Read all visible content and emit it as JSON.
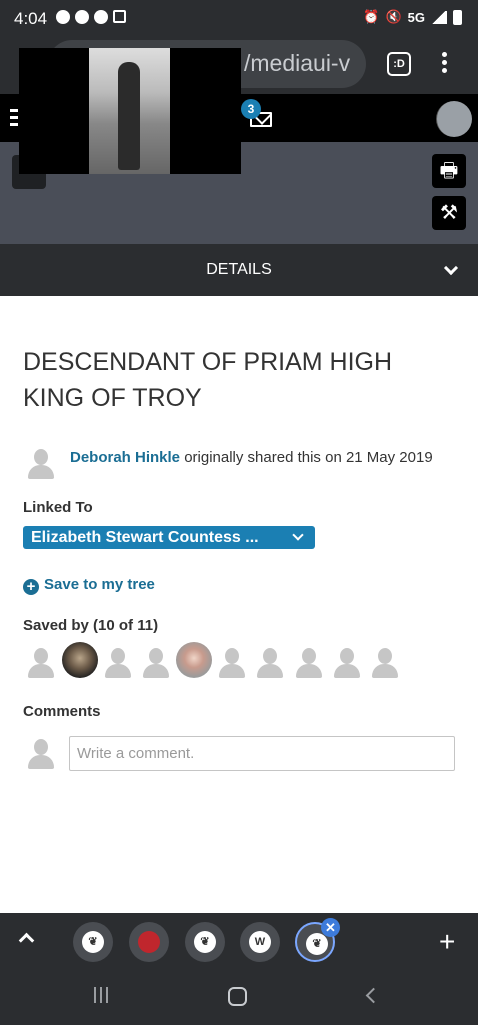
{
  "status_bar": {
    "time": "4:04",
    "network": "5G"
  },
  "browser": {
    "url_fragment": "/mediaui-v",
    "tab_label": ":D"
  },
  "header": {
    "message_count": "3"
  },
  "details_bar": {
    "label": "DETAILS"
  },
  "media": {
    "title": "DESCENDANT OF PRIAM HIGH KING OF TROY",
    "shared_by": "Deborah Hinkle",
    "shared_text": " originally shared this on 21 May 2019"
  },
  "linked_to": {
    "label": "Linked To",
    "person": "Elizabeth Stewart Countess ..."
  },
  "save_tree": {
    "label": "Save to my tree"
  },
  "saved_by": {
    "label": "Saved by (10 of 11)"
  },
  "comments": {
    "label": "Comments",
    "placeholder": "Write a comment."
  },
  "tab_strip": {
    "tabs": [
      "tab-1",
      "tab-2",
      "tab-3",
      "W",
      "tab-5"
    ]
  },
  "colors": {
    "accent": "#1b7fb3",
    "link": "#1b6e94",
    "header_dark": "#2b2d30"
  },
  "icons": {
    "status": [
      "alarm-icon",
      "mute-icon",
      "signal-icon",
      "battery-icon"
    ],
    "toolbar": [
      "print-icon",
      "tools-icon",
      "back-icon",
      "mail-icon"
    ]
  }
}
